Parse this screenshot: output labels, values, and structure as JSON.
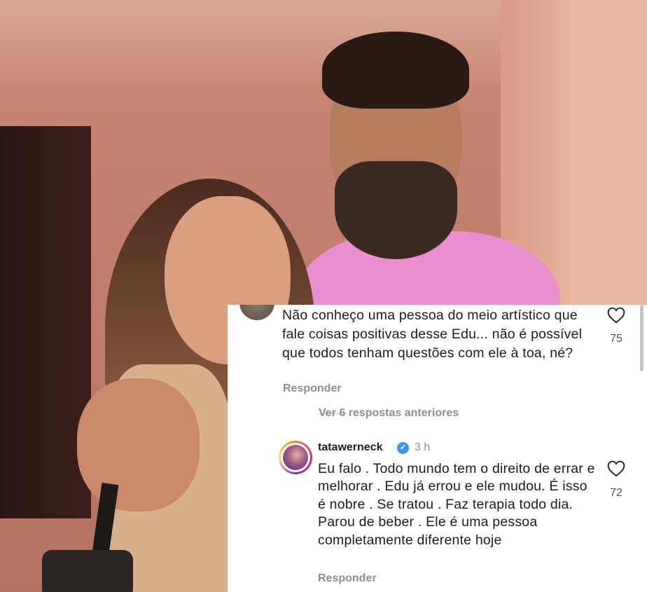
{
  "comments": [
    {
      "text": "Não conheço uma pessoa do meio artístico que fale coisas positivas desse Edu... não é possível que todos tenham questões com ele à toa, né?",
      "likes": "75",
      "reply_label": "Responder",
      "view_replies_label": "Ver 6 respostas anteriores"
    },
    {
      "username": "tatawerneck",
      "verified": true,
      "time": "3 h",
      "text": "Eu falo . Todo mundo tem o direito de errar e melhorar . Edu já errou e ele mudou. É isso é nobre . Se tratou . Faz terapia todo dia. Parou de beber . Ele é uma pessoa completamente diferente hoje",
      "likes": "72",
      "reply_label": "Responder"
    }
  ],
  "icons": {
    "like": "heart-outline-icon",
    "verified": "verified-badge-icon"
  },
  "colors": {
    "verified_blue": "#3897f0",
    "secondary_text": "#8e8e8e",
    "primary_text": "#1c1c1c"
  }
}
